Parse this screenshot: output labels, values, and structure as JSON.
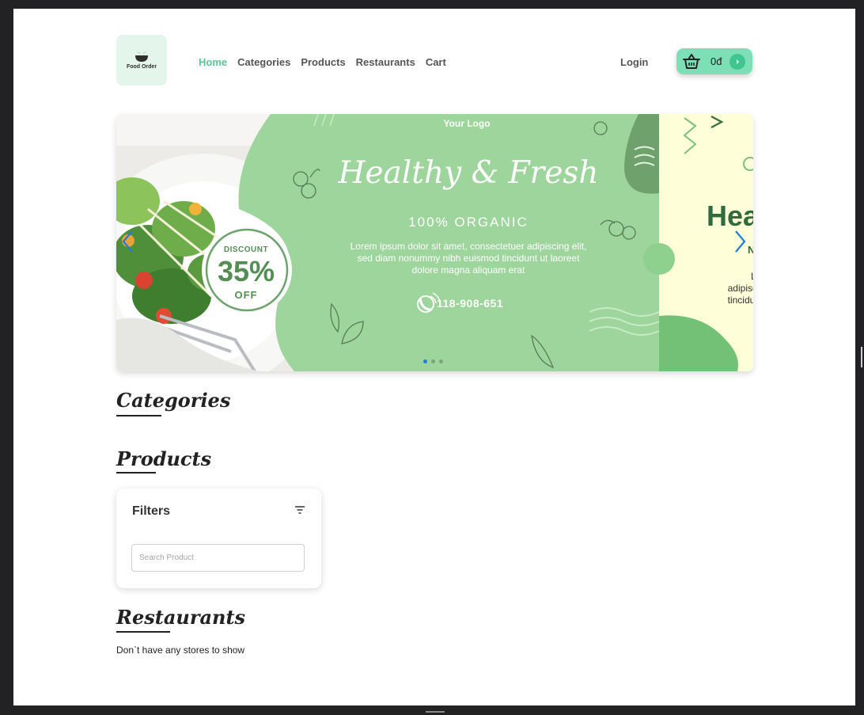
{
  "header": {
    "logo_text": "Food Order",
    "nav": [
      {
        "label": "Home",
        "active": true
      },
      {
        "label": "Categories",
        "active": false
      },
      {
        "label": "Products",
        "active": false
      },
      {
        "label": "Restaurants",
        "active": false
      },
      {
        "label": "Cart",
        "active": false
      }
    ],
    "login_label": "Login",
    "cart_total": "0đ"
  },
  "banner": {
    "your_logo": "Your Logo",
    "headline": "Healthy & Fresh",
    "subline": "100% ORGANIC",
    "body": "Lorem ipsum dolor sit amet, consectetuer adipiscing elit, sed diam nonummy nibh euismod tincidunt ut laoreet dolore magna aliquam erat",
    "phone": "118-908-651",
    "discount_word": "DISCOUNT",
    "discount_value": "35%",
    "discount_off": "OFF",
    "next_slide_headline": "Hea",
    "next_slide_sub": "N",
    "next_slide_body": "Lore adipiscing tincidu vol",
    "slide_count": 3,
    "active_slide": 1,
    "colors": {
      "green": "#9ed59c",
      "dark_green": "#5e9a5d",
      "cream": "#fefed8"
    }
  },
  "sections": {
    "categories_title": "Categories",
    "products_title": "Products",
    "restaurants_title": "Restaurants"
  },
  "filters": {
    "title": "Filters",
    "search_placeholder": "Search Product",
    "search_value": ""
  },
  "restaurants": {
    "empty_message": "Don`t have any stores to show"
  },
  "theme": {
    "accent": "#5cc491",
    "cart_bg": "#7ddfb6"
  }
}
